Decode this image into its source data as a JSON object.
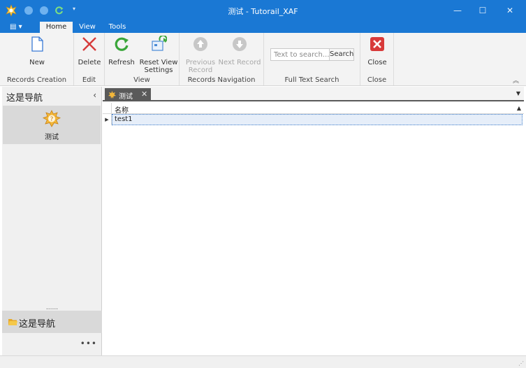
{
  "window": {
    "title": "测试 - Tutorail_XAF",
    "minimize_label": "—",
    "maximize_label": "☐",
    "close_label": "✕",
    "accent": "#1a78d4"
  },
  "ribbon_tabs": [
    {
      "label": "Home"
    },
    {
      "label": "View"
    },
    {
      "label": "Tools"
    }
  ],
  "file_menu_label": "▤ ▾",
  "ribbon": {
    "groups": {
      "records_creation": "Records Creation",
      "edit": "Edit",
      "view": "View",
      "records_navigation": "Records Navigation",
      "full_text_search": "Full Text Search",
      "close": "Close"
    },
    "buttons": {
      "new": "New",
      "delete": "Delete",
      "refresh": "Refresh",
      "reset_view_1": "Reset View",
      "reset_view_2": "Settings",
      "previous_1": "Previous",
      "previous_2": "Record",
      "next": "Next Record",
      "close": "Close"
    },
    "search": {
      "placeholder": "Text to search...",
      "button": "Search"
    }
  },
  "navigation": {
    "title": "这是导航",
    "collapse_glyph": "‹",
    "item_label": "测试",
    "splitter": "......",
    "group_label": "这是导航",
    "more": "•••"
  },
  "document": {
    "tab_label": "测试",
    "tab_close": "✕",
    "column_name": "名称",
    "rows": [
      {
        "name": "test1"
      }
    ]
  }
}
